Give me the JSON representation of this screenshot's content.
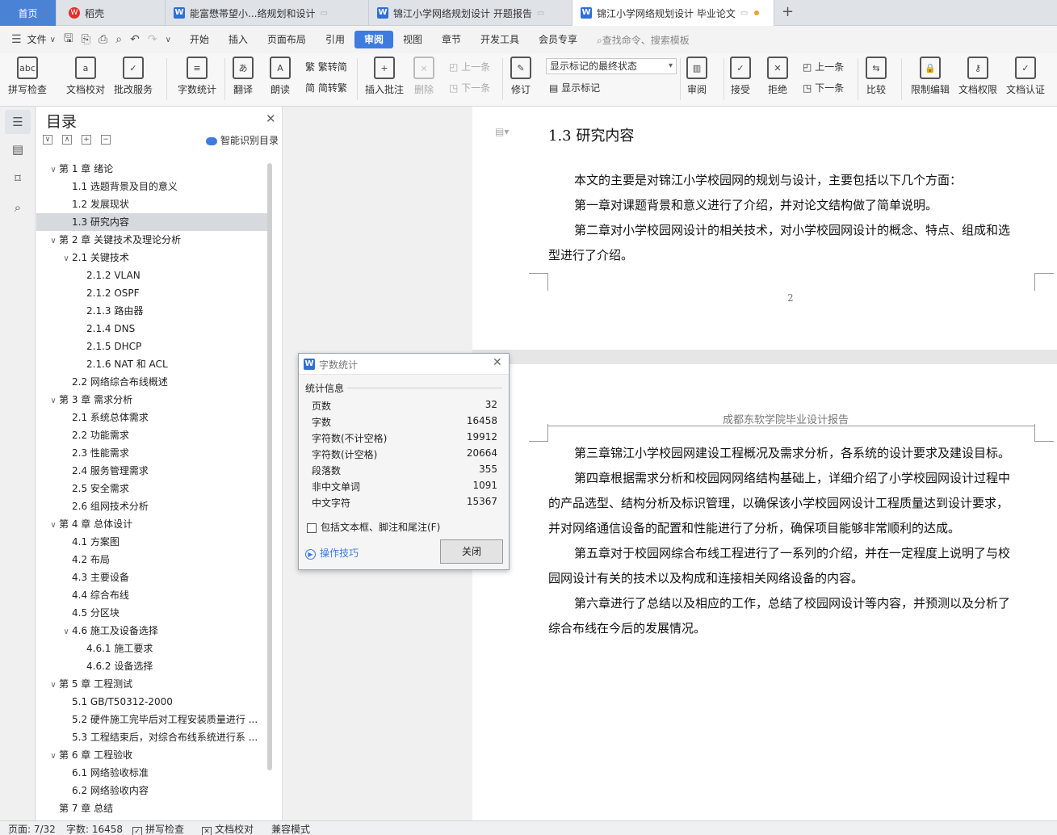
{
  "tabs": {
    "home": "首页",
    "daoke": "稻壳",
    "doc1": "能富懋帯望小...络规划和设计",
    "doc2": "锦江小学网络规划设计 开题报告",
    "doc3": "锦江小学网络规划设计 毕业论文",
    "new_tab": "+"
  },
  "menu": {
    "file": "文件",
    "items": [
      "开始",
      "插入",
      "页面布局",
      "引用",
      "审阅",
      "视图",
      "章节",
      "开发工具",
      "会员专享"
    ],
    "active": "审阅",
    "search_placeholder": "查找命令、搜索模板"
  },
  "ribbon": {
    "spell_check": "拼写检查",
    "doc_proof": "文档校对",
    "batch_service": "批改服务",
    "word_count": "字数统计",
    "translate": "翻译",
    "read_aloud": "朗读",
    "to_traditional": "繁转简",
    "to_simplified": "简转繁",
    "insert_comment": "插入批注",
    "delete": "删除",
    "prev_comment": "上一条",
    "next_comment": "下一条",
    "revise": "修订",
    "markup_mode": "显示标记的最终状态",
    "show_markup": "显示标记",
    "review": "审阅",
    "accept": "接受",
    "reject": "拒绝",
    "prev_change": "上一条",
    "next_change": "下一条",
    "compare": "比较",
    "restrict_edit": "限制编辑",
    "doc_permission": "文档权限",
    "doc_cert": "文档认证"
  },
  "toc": {
    "title": "目录",
    "smart_toc": "智能识别目录",
    "items": [
      {
        "level": 1,
        "text": "第 1 章  绪论",
        "arrow": "∨"
      },
      {
        "level": 2,
        "text": "1.1  选题背景及目的意义",
        "arrow": ""
      },
      {
        "level": 2,
        "text": "1.2  发展现状",
        "arrow": ""
      },
      {
        "level": 2,
        "text": "1.3  研究内容",
        "arrow": "",
        "selected": true
      },
      {
        "level": 1,
        "text": "第 2 章  关键技术及理论分析",
        "arrow": "∨"
      },
      {
        "level": 2,
        "text": "2.1  关键技术",
        "arrow": "∨"
      },
      {
        "level": 3,
        "text": "2.1.2 VLAN",
        "arrow": ""
      },
      {
        "level": 3,
        "text": "2.1.2 OSPF",
        "arrow": ""
      },
      {
        "level": 3,
        "text": "2.1.3  路由器",
        "arrow": ""
      },
      {
        "level": 3,
        "text": "2.1.4 DNS",
        "arrow": ""
      },
      {
        "level": 3,
        "text": "2.1.5 DHCP",
        "arrow": ""
      },
      {
        "level": 3,
        "text": "2.1.6 NAT 和 ACL",
        "arrow": ""
      },
      {
        "level": 2,
        "text": "2.2  网络综合布线概述",
        "arrow": ""
      },
      {
        "level": 1,
        "text": "第 3 章  需求分析",
        "arrow": "∨"
      },
      {
        "level": 2,
        "text": "2.1  系统总体需求",
        "arrow": ""
      },
      {
        "level": 2,
        "text": "2.2  功能需求",
        "arrow": ""
      },
      {
        "level": 2,
        "text": "2.3  性能需求",
        "arrow": ""
      },
      {
        "level": 2,
        "text": "2.4  服务管理需求",
        "arrow": ""
      },
      {
        "level": 2,
        "text": "2.5  安全需求",
        "arrow": ""
      },
      {
        "level": 2,
        "text": "2.6  组网技术分析",
        "arrow": ""
      },
      {
        "level": 1,
        "text": "第 4 章  总体设计",
        "arrow": "∨"
      },
      {
        "level": 2,
        "text": "4.1  方案图",
        "arrow": ""
      },
      {
        "level": 2,
        "text": "4.2  布局",
        "arrow": ""
      },
      {
        "level": 2,
        "text": "4.3  主要设备",
        "arrow": ""
      },
      {
        "level": 2,
        "text": "4.4  综合布线",
        "arrow": ""
      },
      {
        "level": 2,
        "text": "4.5  分区块",
        "arrow": ""
      },
      {
        "level": 2,
        "text": "4.6  施工及设备选择",
        "arrow": "∨"
      },
      {
        "level": 3,
        "text": "4.6.1  施工要求",
        "arrow": ""
      },
      {
        "level": 3,
        "text": "4.6.2  设备选择",
        "arrow": ""
      },
      {
        "level": 1,
        "text": "第 5 章  工程测试",
        "arrow": "∨"
      },
      {
        "level": 2,
        "text": "5.1 GB/T50312-2000",
        "arrow": ""
      },
      {
        "level": 2,
        "text": "5.2  硬件施工完毕后对工程安装质量进行 ...",
        "arrow": ""
      },
      {
        "level": 2,
        "text": "5.3  工程结束后，对综合布线系统进行系 ...",
        "arrow": ""
      },
      {
        "level": 1,
        "text": "第 6 章  工程验收",
        "arrow": "∨"
      },
      {
        "level": 2,
        "text": "6.1  网络验收标准",
        "arrow": ""
      },
      {
        "level": 2,
        "text": "6.2  网络验收内容",
        "arrow": ""
      },
      {
        "level": 1,
        "text": "第 7 章  总结",
        "arrow": ""
      }
    ]
  },
  "document": {
    "heading": "1.3  研究内容",
    "p1": "本文的主要是对锦江小学校园网的规划与设计，主要包括以下几个方面：",
    "p2": "第一章对课题背景和意义进行了介绍，并对论文结构做了简单说明。",
    "p3a": "第二章对小学校园网设计的相关技术，对小学校园网设计的概念、特点、组成和选",
    "p3b": "型进行了介绍。",
    "page_number": "2",
    "running_header": "成都东软学院毕业设计报告",
    "p4": "第三章锦江小学校园网建设工程概况及需求分析，各系统的设计要求及建设目标。",
    "p5a": "第四章根据需求分析和校园网网络结构基础上，详细介绍了小学校园网设计过程中",
    "p5b": "的产品选型、结构分析及标识管理，以确保该小学校园网设计工程质量达到设计要求，",
    "p5c": "并对网络通信设备的配置和性能进行了分析，确保项目能够非常顺利的达成。",
    "p6a": "第五章对于校园网综合布线工程进行了一系列的介绍，并在一定程度上说明了与校",
    "p6b": "园网设计有关的技术以及构成和连接相关网络设备的内容。",
    "p7a": "第六章进行了总结以及相应的工作，总结了校园网设计等内容，并预测以及分析了",
    "p7b": "综合布线在今后的发展情况。"
  },
  "dialog": {
    "title": "字数统计",
    "section": "统计信息",
    "stats": [
      {
        "label": "页数",
        "value": "32"
      },
      {
        "label": "字数",
        "value": "16458"
      },
      {
        "label": "字符数(不计空格)",
        "value": "19912"
      },
      {
        "label": "字符数(计空格)",
        "value": "20664"
      },
      {
        "label": "段落数",
        "value": "355"
      },
      {
        "label": "非中文单词",
        "value": "1091"
      },
      {
        "label": "中文字符",
        "value": "15367"
      }
    ],
    "include_label": "包括文本框、脚注和尾注(F)",
    "tips": "操作技巧",
    "close": "关闭"
  },
  "status": {
    "page": "页面: 7/32",
    "words": "字数: 16458",
    "spell": "拼写检查",
    "proof": "文档校对",
    "compat": "兼容模式"
  },
  "colors": {
    "accent": "#3d7be0",
    "home_tab": "#4a82d6"
  }
}
